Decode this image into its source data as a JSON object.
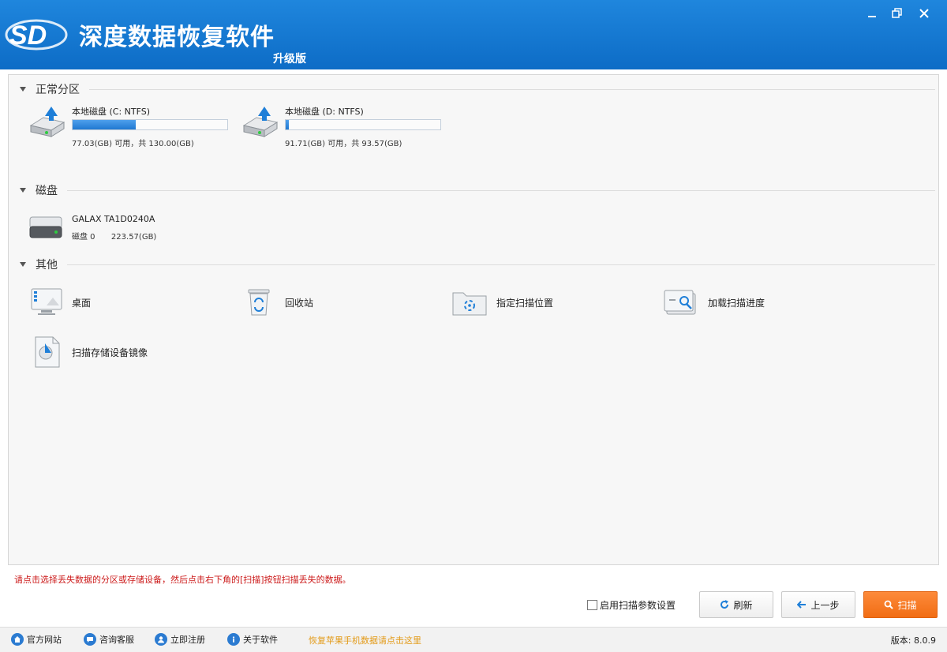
{
  "window": {
    "logo_text": "SD",
    "title": "深度数据恢复软件",
    "subtitle": "升级版",
    "minimize_symbol": "—",
    "close_symbol": "✕"
  },
  "sections": {
    "partitions": "正常分区",
    "disks": "磁盘",
    "others": "其他"
  },
  "partitions": [
    {
      "name": "本地磁盘 (C: NTFS)",
      "usage": "77.03(GB) 可用，共 130.00(GB)",
      "used_fraction": 0.41
    },
    {
      "name": "本地磁盘 (D: NTFS)",
      "usage": "91.71(GB) 可用，共 93.57(GB)",
      "used_fraction": 0.02
    }
  ],
  "disks": [
    {
      "name": "GALAX TA1D0240A",
      "label": "磁盘 0",
      "size": "223.57(GB)"
    }
  ],
  "others": [
    {
      "label": "桌面",
      "icon": "desktop-icon"
    },
    {
      "label": "回收站",
      "icon": "recycle-bin-icon"
    },
    {
      "label": "指定扫描位置",
      "icon": "folder-target-icon"
    },
    {
      "label": "加载扫描进度",
      "icon": "load-progress-icon"
    },
    {
      "label": "扫描存储设备镜像",
      "icon": "image-file-icon"
    }
  ],
  "hint": "请点击选择丢失数据的分区或存储设备，然后点击右下角的[扫描]按钮扫描丢失的数据。",
  "options": {
    "scan_params_label": "启用扫描参数设置",
    "scan_params_checked": false
  },
  "buttons": {
    "refresh": "刷新",
    "back": "上一步",
    "scan": "扫描"
  },
  "status": {
    "links": [
      {
        "label": "官方网站",
        "icon": "home-icon"
      },
      {
        "label": "咨询客服",
        "icon": "chat-icon"
      },
      {
        "label": "立即注册",
        "icon": "user-icon"
      },
      {
        "label": "关于软件",
        "icon": "info-icon"
      }
    ],
    "promo": "恢复苹果手机数据请点击这里",
    "version": "版本: 8.0.9"
  },
  "colors": {
    "titlebar": "#1a7dd7",
    "accent": "#f47a22",
    "hint": "#cc1a1a",
    "promo": "#e39a17",
    "progress": "#2f88e0"
  }
}
